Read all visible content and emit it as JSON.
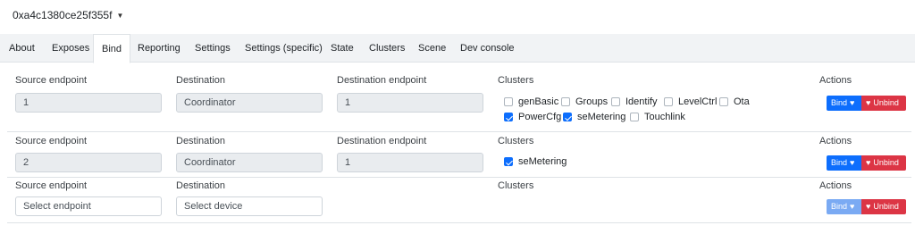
{
  "device": {
    "title": "0xa4c1380ce25f355f",
    "chevron_icon": "chevron-down-icon"
  },
  "tabs": [
    "About",
    "Exposes",
    "Bind",
    "Reporting",
    "Settings",
    "Settings (specific)",
    "State",
    "Clusters",
    "Scene",
    "Dev console"
  ],
  "active_tab": "Bind",
  "labels": {
    "source_endpoint": "Source endpoint",
    "destination": "Destination",
    "destination_endpoint": "Destination endpoint",
    "clusters": "Clusters",
    "actions": "Actions"
  },
  "buttons": {
    "bind": "Bind",
    "unbind": "Unbind",
    "heart_icon": "heart-icon",
    "broken_heart_icon": "broken-heart-icon"
  },
  "rows": [
    {
      "source_endpoint": "1",
      "destination": "Coordinator",
      "destination_endpoint": "1",
      "clusters": [
        {
          "name": "genBasic",
          "checked": false
        },
        {
          "name": "Groups",
          "checked": false
        },
        {
          "name": "Identify",
          "checked": false
        },
        {
          "name": "LevelCtrl",
          "checked": false
        },
        {
          "name": "Ota",
          "checked": false
        },
        {
          "name": "PowerCfg",
          "checked": true
        },
        {
          "name": "seMetering",
          "checked": true
        },
        {
          "name": "Touchlink",
          "checked": false
        }
      ]
    },
    {
      "source_endpoint": "2",
      "destination": "Coordinator",
      "destination_endpoint": "1",
      "clusters": [
        {
          "name": "seMetering",
          "checked": true
        }
      ]
    },
    {
      "source_endpoint_placeholder": "Select endpoint",
      "destination_placeholder": "Select device",
      "clusters": []
    }
  ],
  "colors": {
    "primary": "#0d6efd",
    "danger": "#dc3545",
    "readonly_bg": "#e9ecef"
  }
}
